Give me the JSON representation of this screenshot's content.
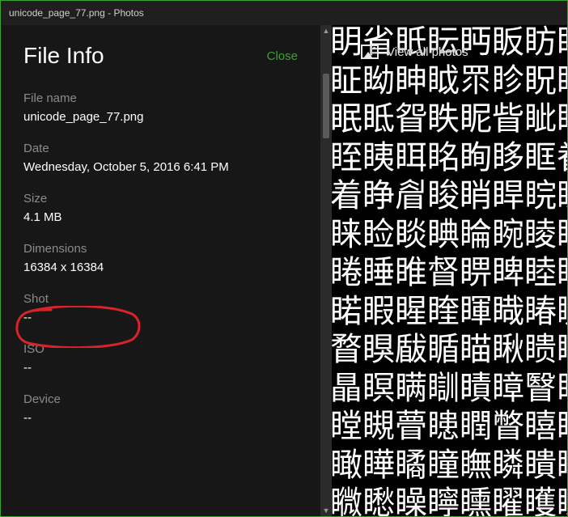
{
  "titlebar": {
    "text": "unicode_page_77.png - Photos"
  },
  "info": {
    "title": "File Info",
    "close": "Close",
    "fields": {
      "filename": {
        "label": "File name",
        "value": "unicode_page_77.png"
      },
      "date": {
        "label": "Date",
        "value": "Wednesday, October 5, 2016 6:41 PM"
      },
      "size": {
        "label": "Size",
        "value": "4.1 MB"
      },
      "dims": {
        "label": "Dimensions",
        "value": "16384 x 16384"
      },
      "shot": {
        "label": "Shot",
        "value": "--"
      },
      "iso": {
        "label": "ISO",
        "value": "--"
      },
      "device": {
        "label": "Device",
        "value": "--"
      }
    }
  },
  "preview": {
    "view_all": "View all photos",
    "glyph_rows": [
      "眀省眂眃眄眅眆眇",
      "眐眑眒眓眔眕眖眗",
      "眠眡眢眣眤眥眦眧",
      "眰眱眲眳眴眵眶眷",
      "着睁睂睃睄睅睆睇",
      "睐睑睒睓睔睕睖睗",
      "睠睡睢督睤睥睦睧",
      "睰睱睲睳睴睵睶睷",
      "瞀瞁瞂瞃瞄瞅瞆瞇",
      "瞐瞑瞒瞓瞔瞕瞖瞗",
      "瞠瞡瞢瞣瞤瞥瞦瞧",
      "瞰瞱瞲瞳瞴瞵瞶瞷",
      "矀矁矂矃矄矅矆矇"
    ]
  },
  "annotation": {
    "stroke": "#d8232a"
  }
}
